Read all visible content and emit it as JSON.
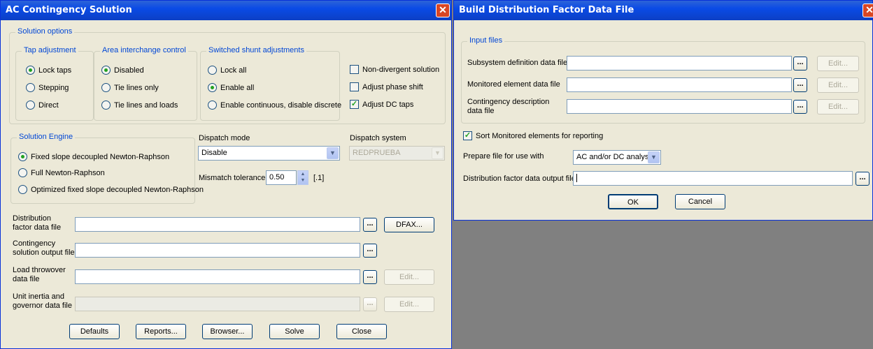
{
  "left_window": {
    "title": "AC Contingency Solution",
    "solution_options": {
      "title": "Solution options",
      "tap_adjustment": {
        "title": "Tap adjustment",
        "options": [
          "Lock taps",
          "Stepping",
          "Direct"
        ],
        "selected": "Lock taps"
      },
      "area_interchange": {
        "title": "Area interchange control",
        "options": [
          "Disabled",
          "Tie lines only",
          "Tie lines and loads"
        ],
        "selected": "Disabled"
      },
      "switched_shunt": {
        "title": "Switched shunt adjustments",
        "options": [
          "Lock all",
          "Enable all",
          "Enable continuous, disable discrete"
        ],
        "selected": "Enable all"
      },
      "checkboxes": [
        {
          "label": "Non-divergent solution",
          "checked": false
        },
        {
          "label": "Adjust phase shift",
          "checked": false
        },
        {
          "label": "Adjust DC taps",
          "checked": true
        }
      ]
    },
    "solution_engine": {
      "title": "Solution Engine",
      "options": [
        "Fixed slope decoupled Newton-Raphson",
        "Full Newton-Raphson",
        "Optimized fixed slope decoupled Newton-Raphson"
      ],
      "selected": "Fixed slope decoupled Newton-Raphson"
    },
    "dispatch_mode": {
      "label": "Dispatch mode",
      "value": "Disable"
    },
    "dispatch_system": {
      "label": "Dispatch system",
      "value": "REDPRUEBA"
    },
    "mismatch": {
      "label": "Mismatch tolerance",
      "value": "0.50",
      "unit": "[.1]"
    },
    "files": [
      {
        "label": "Distribution factor data file",
        "value": "",
        "extra_button": "DFAX..."
      },
      {
        "label": "Contingency solution output file",
        "value": ""
      },
      {
        "label": "Load throwover data file",
        "value": "",
        "extra_button": "Edit..."
      },
      {
        "label": "Unit inertia and governor data file",
        "value": "",
        "extra_button": "Edit..."
      }
    ],
    "browse_label": "...",
    "buttons": [
      "Defaults",
      "Reports...",
      "Browser...",
      "Solve",
      "Close"
    ]
  },
  "right_window": {
    "title": "Build Distribution Factor Data File",
    "input_files": {
      "title": "Input files",
      "rows": [
        {
          "label": "Subsystem definition data file",
          "value": "",
          "edit": "Edit..."
        },
        {
          "label": "Monitored element data file",
          "value": "",
          "edit": "Edit..."
        },
        {
          "label": "Contingency description data file",
          "value": "",
          "edit": "Edit..."
        }
      ]
    },
    "sort_checkbox": {
      "label": "Sort Monitored elements for reporting",
      "checked": true
    },
    "prepare": {
      "label": "Prepare file for use with",
      "value": "AC and/or DC analysis"
    },
    "output": {
      "label": "Distribution factor data output file",
      "value": ""
    },
    "ok": "OK",
    "cancel": "Cancel"
  },
  "icons": {
    "close": "close-icon",
    "checkmark": "check-icon",
    "dropdown": "chevron-down-icon"
  }
}
